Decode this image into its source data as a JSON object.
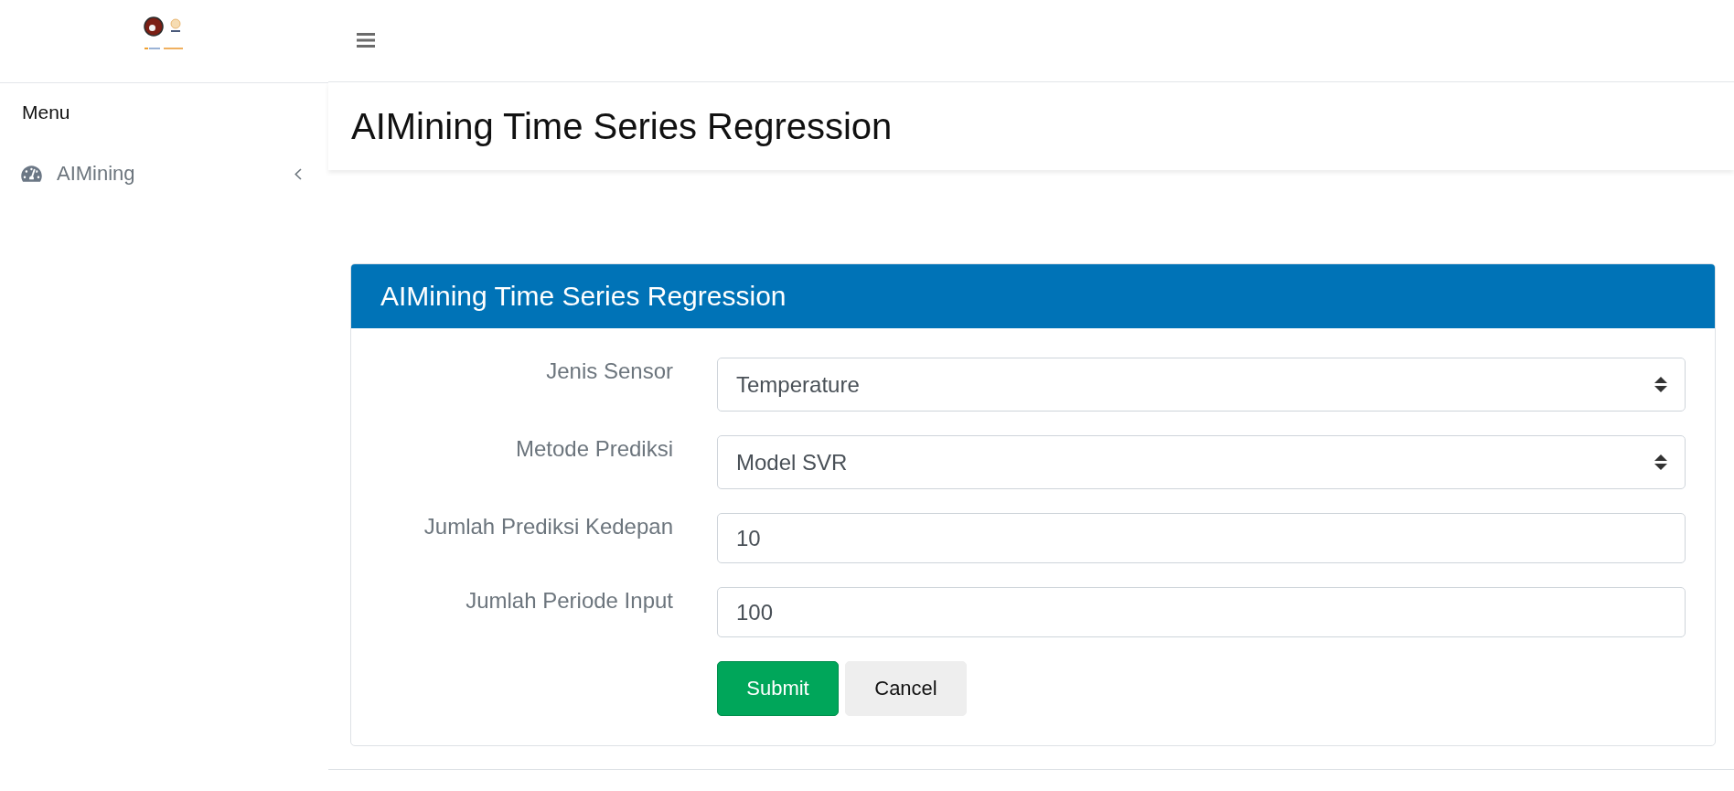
{
  "sidebar": {
    "heading": "Menu",
    "items": [
      {
        "label": "AIMining",
        "selected": false,
        "expanded": false
      }
    ]
  },
  "page_title": "AIMining Time Series Regression",
  "card": {
    "title": "AIMining Time Series Regression",
    "fields": [
      {
        "kind": "select",
        "label": "Jenis Sensor",
        "value": "Temperature"
      },
      {
        "kind": "select",
        "label": "Metode Prediksi",
        "value": "Model SVR"
      },
      {
        "kind": "input",
        "label": "Jumlah Prediksi Kedepan",
        "value": "10"
      },
      {
        "kind": "input",
        "label": "Jumlah Periode Input",
        "value": "100"
      }
    ],
    "buttons": [
      {
        "kind": "success",
        "label": "Submit"
      },
      {
        "kind": "default",
        "label": "Cancel"
      }
    ]
  }
}
